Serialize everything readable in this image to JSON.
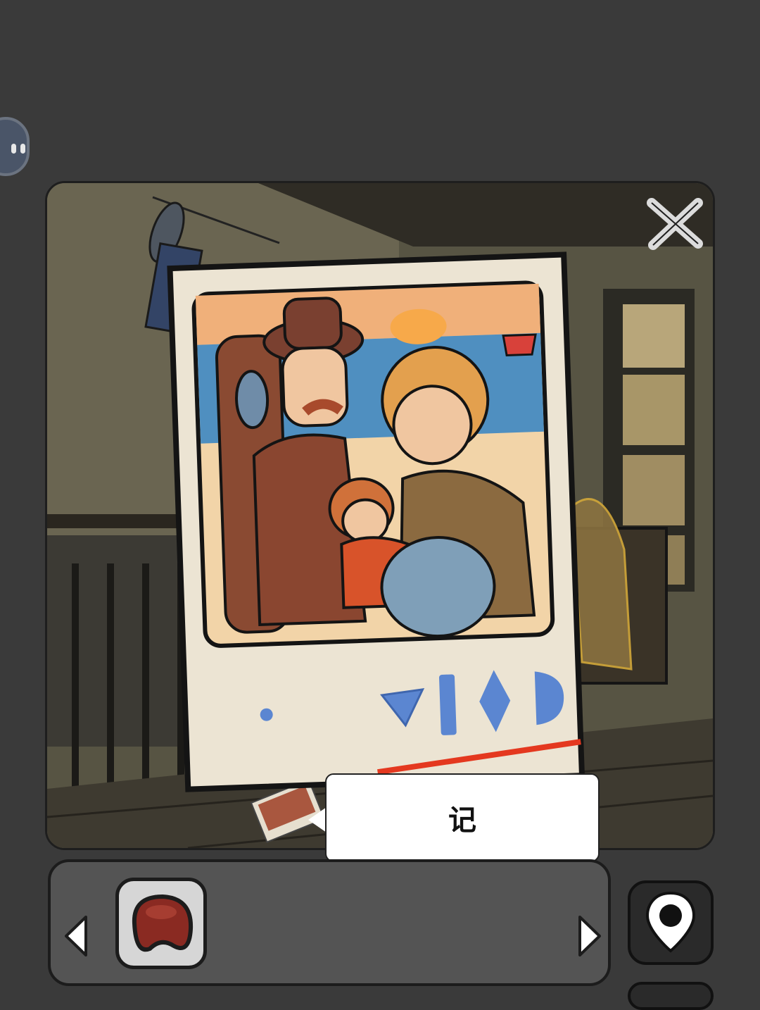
{
  "hint": {
    "text": "记"
  },
  "icons": {
    "assistant": "assistant-bubble-icon",
    "close": "close-x-icon",
    "prev": "triangle-left-icon",
    "next": "triangle-right-icon",
    "map": "map-pin-icon",
    "item": "brown-kidney-bean-item-icon"
  },
  "colors": {
    "background": "#3a3a3a",
    "inventory_bar": "#545454",
    "slot": "#d6d6d6",
    "symbol_blue": "#5b86d1",
    "underline_red": "#e4381f"
  }
}
